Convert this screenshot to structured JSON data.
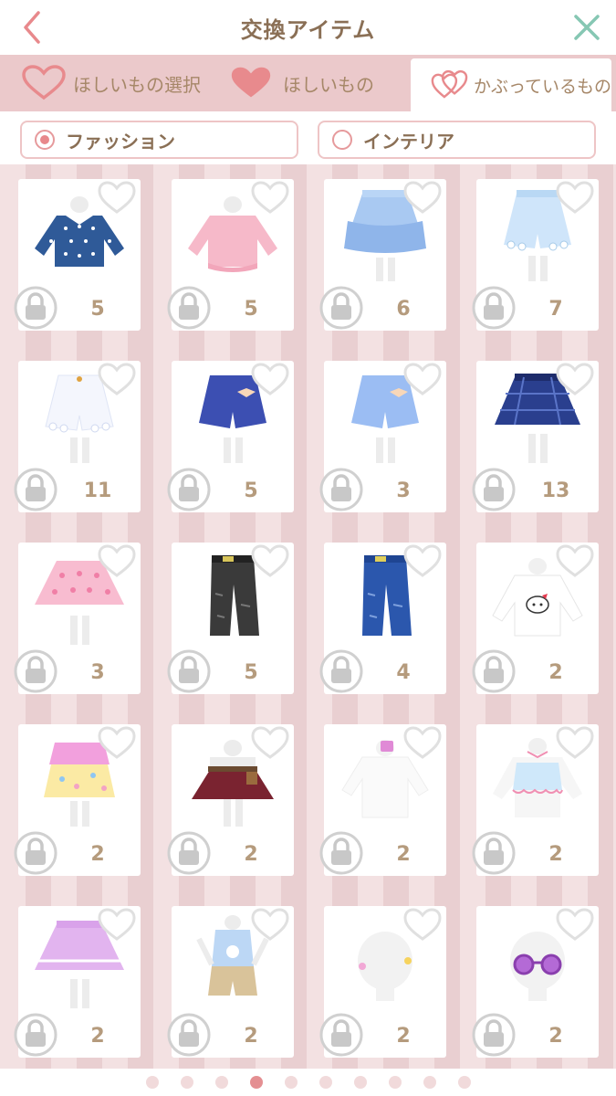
{
  "header": {
    "title": "交換アイテム",
    "back_icon": "chevron-left-icon",
    "close_icon": "close-icon",
    "back_color": "#e8898c",
    "close_color": "#86c7b3"
  },
  "tabs": [
    {
      "label": "ほしいもの選択",
      "icon": "heart-outline-icon",
      "active": false
    },
    {
      "label": "ほしいもの",
      "icon": "heart-filled-icon",
      "active": false
    },
    {
      "label": "かぶっているもの",
      "icon": "double-heart-icon",
      "active": true
    }
  ],
  "filters": [
    {
      "label": "ファッション",
      "selected": true
    },
    {
      "label": "インテリア",
      "selected": false
    }
  ],
  "items": [
    {
      "name": "navy polka-dot sweater",
      "count": "5"
    },
    {
      "name": "pink sweater",
      "count": "5"
    },
    {
      "name": "light blue tiered skirt",
      "count": "6"
    },
    {
      "name": "light blue shorts",
      "count": "7"
    },
    {
      "name": "white shorts",
      "count": "11"
    },
    {
      "name": "navy bow shorts",
      "count": "5"
    },
    {
      "name": "light blue bow shorts",
      "count": "3"
    },
    {
      "name": "navy plaid skirt",
      "count": "13"
    },
    {
      "name": "pink polka-dot skirt",
      "count": "3"
    },
    {
      "name": "black ripped jeans",
      "count": "5"
    },
    {
      "name": "blue ripped jeans",
      "count": "4"
    },
    {
      "name": "white hello kitty top",
      "count": "2"
    },
    {
      "name": "pastel ruffle shorts",
      "count": "2"
    },
    {
      "name": "brown belted skirt",
      "count": "2"
    },
    {
      "name": "white top with pin",
      "count": "2"
    },
    {
      "name": "frill camisole",
      "count": "2"
    },
    {
      "name": "lavender skirt",
      "count": "2"
    },
    {
      "name": "tank top and shorts",
      "count": "2"
    },
    {
      "name": "hair clips",
      "count": "2"
    },
    {
      "name": "purple sunglasses",
      "count": "2"
    }
  ],
  "pagination": {
    "total": 10,
    "current": 4
  },
  "colors": {
    "accent": "#e8888b",
    "count_text": "#b59b7d",
    "title_text": "#8a6f55"
  }
}
